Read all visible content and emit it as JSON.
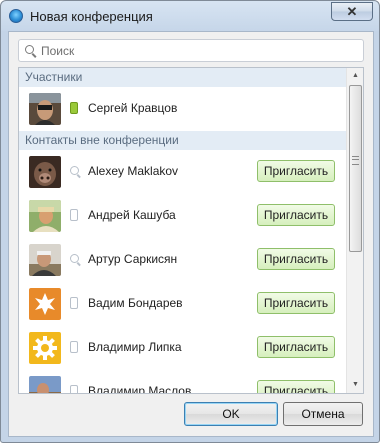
{
  "window": {
    "title": "Новая конференция",
    "close_label": "✕"
  },
  "search": {
    "placeholder": "Поиск"
  },
  "sections": {
    "participants": "Участники",
    "contacts": "Контакты вне конференции"
  },
  "participants": [
    {
      "name": "Сергей Кравцов",
      "status": "phone-online-icon",
      "avatar": "photo"
    }
  ],
  "invite_label": "Пригласить",
  "contacts": [
    {
      "name": "Alexey Maklakov",
      "status": "search-icon",
      "avatar": "photo"
    },
    {
      "name": "Андрей Кашуба",
      "status": "phone-icon",
      "avatar": "photo"
    },
    {
      "name": "Артур Саркисян",
      "status": "search-icon",
      "avatar": "photo"
    },
    {
      "name": "Вадим Бондарев",
      "status": "phone-icon",
      "avatar": "orange-star-icon"
    },
    {
      "name": "Владимир Липка",
      "status": "phone-icon",
      "avatar": "yellow-gear-icon"
    },
    {
      "name": "Владимир Маслов",
      "status": "phone-icon",
      "avatar": "photo"
    }
  ],
  "buttons": {
    "ok": "OK",
    "cancel": "Отмена"
  },
  "colors": {
    "invite_bg": "#d6efbd",
    "invite_border": "#8fbf6a",
    "section_bg": "#e3ecf5",
    "online_green": "#9ac93a"
  }
}
